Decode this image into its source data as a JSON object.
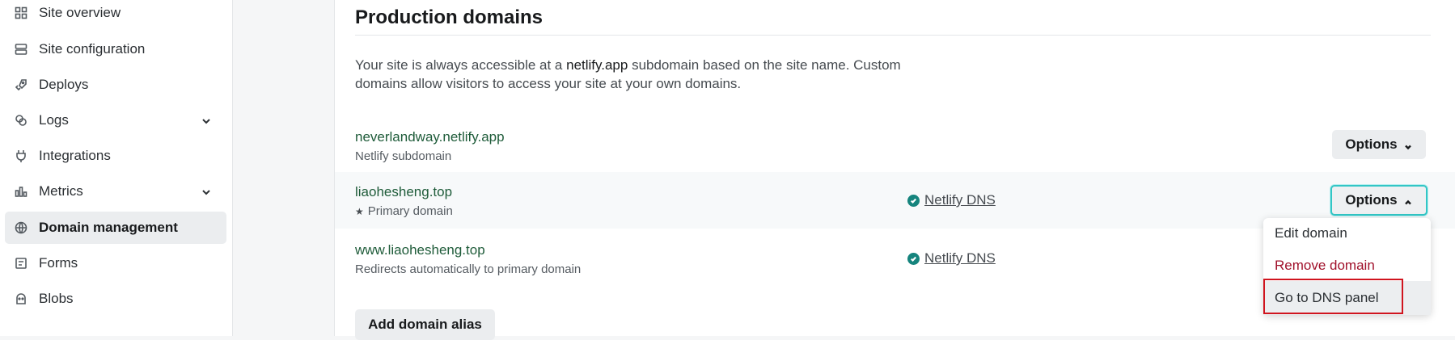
{
  "sidebar": {
    "items": [
      {
        "label": "Site overview",
        "icon": "grid-icon"
      },
      {
        "label": "Site configuration",
        "icon": "server-icon"
      },
      {
        "label": "Deploys",
        "icon": "rocket-icon"
      },
      {
        "label": "Logs",
        "icon": "logs-icon",
        "expandable": true
      },
      {
        "label": "Integrations",
        "icon": "plug-icon"
      },
      {
        "label": "Metrics",
        "icon": "bar-chart-icon",
        "expandable": true
      },
      {
        "label": "Domain management",
        "icon": "globe-icon",
        "active": true
      },
      {
        "label": "Forms",
        "icon": "form-icon"
      },
      {
        "label": "Blobs",
        "icon": "blob-icon"
      }
    ]
  },
  "section": {
    "title": "Production domains",
    "description_part1": "Your site is always accessible at a ",
    "description_highlight": "netlify.app",
    "description_part2": " subdomain based on the site name. Custom domains allow visitors to access your site at your own domains."
  },
  "domains": [
    {
      "name": "neverlandway.netlify.app",
      "subtitle": "Netlify subdomain",
      "dns": "",
      "options_label": "Options"
    },
    {
      "name": "liaohesheng.top",
      "subtitle": "Primary domain",
      "dns": "Netlify DNS",
      "options_label": "Options",
      "primary": true
    },
    {
      "name": "www.liaohesheng.top",
      "subtitle": "Redirects automatically to primary domain",
      "dns": "Netlify DNS"
    }
  ],
  "add_alias_label": "Add domain alias",
  "options_menu": {
    "items": [
      "Edit domain",
      "Remove domain",
      "Go to DNS panel"
    ]
  },
  "colors": {
    "accent": "#32c6c6",
    "domain_link": "#1f5c3a",
    "danger": "#a0102a",
    "check": "#15847d"
  }
}
